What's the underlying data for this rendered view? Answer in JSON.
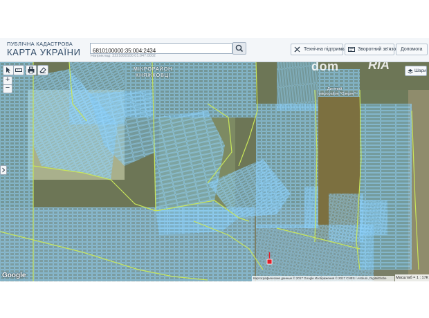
{
  "header": {
    "brand_top": "ПУБЛІЧНА КАДАСТРОВА",
    "brand_main": "КАРТА УКРАЇНИ",
    "search_value": "6810100000:35:004:2434",
    "search_hint": "Наприклад: 3221000100:01:047:0002",
    "buttons": [
      {
        "label": "Технічна підтримка",
        "icon": "wrench-icon"
      },
      {
        "label": "Зворотний зв'язок",
        "icon": "feedback-icon"
      },
      {
        "label": "Допомога",
        "icon": "help-icon"
      }
    ]
  },
  "map": {
    "district_label_1": "МІКРОРАЙОН",
    "district_label_2": "КНЯЖКОВЦІ",
    "poi_1": "Дитячий",
    "poi_2": "мікрорайон \"Озерне\"",
    "layers_label": "Шари",
    "google": "Google",
    "attribution": "Картографические данные © 2017 Google Изображения © 2017 CNES / Astrium, DigitalGlobe",
    "scale": "Масштаб = 1 : 17К",
    "watermark_dom": "dom",
    "watermark_ria": "RIA",
    "marker_color": "#e0202a",
    "parcel_color": "#7fd0ff",
    "boundary_color": "#c8e65a"
  },
  "tools": {
    "zoom_in": "+",
    "zoom_out": "−"
  }
}
